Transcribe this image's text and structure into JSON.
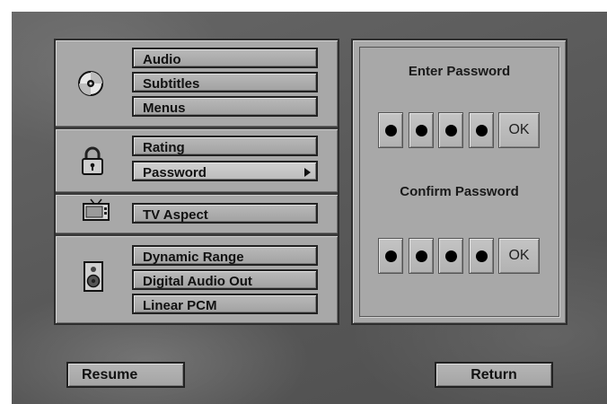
{
  "menu": {
    "groups": [
      {
        "icon": "disc-icon",
        "items": [
          {
            "label": "Audio"
          },
          {
            "label": "Subtitles"
          },
          {
            "label": "Menus"
          }
        ]
      },
      {
        "icon": "lock-icon",
        "items": [
          {
            "label": "Rating"
          },
          {
            "label": "Password",
            "selected": true,
            "has_submenu": true
          }
        ]
      },
      {
        "icon": "tv-icon",
        "items": [
          {
            "label": "TV Aspect"
          }
        ]
      },
      {
        "icon": "speaker-icon",
        "items": [
          {
            "label": "Dynamic Range"
          },
          {
            "label": "Digital Audio Out"
          },
          {
            "label": "Linear PCM"
          }
        ]
      }
    ]
  },
  "password_panel": {
    "enter_title": "Enter Password",
    "confirm_title": "Confirm Password",
    "digit_count": 4,
    "entered_digits": 4,
    "confirmed_digits": 4,
    "ok_label": "OK"
  },
  "footer": {
    "resume_label": "Resume",
    "return_label": "Return"
  },
  "colors": {
    "background": "#5c5c5c",
    "panel": "#a8a8a8",
    "border": "#222222"
  }
}
